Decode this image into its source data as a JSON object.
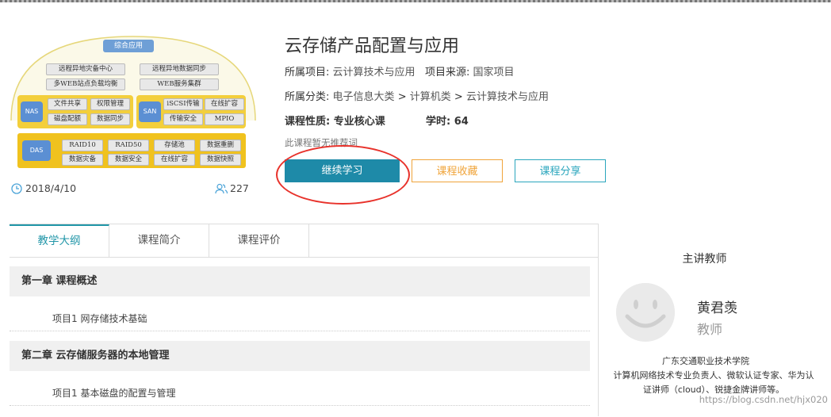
{
  "course": {
    "title": "云存储产品配置与应用",
    "project_label": "所属项目:",
    "project_value": "云计算技术与应用",
    "source_label": "项目来源:",
    "source_value": "国家项目",
    "category_label": "所属分类:",
    "category_path": [
      "电子信息大类",
      "计算机类",
      "云计算技术与应用"
    ],
    "breadcrumb_sep": ">",
    "nature_label": "课程性质: 专业核心课",
    "hours_label": "学时:",
    "hours_value": "64",
    "no_recommendation": "此课程暂无推荐词",
    "date": "2018/4/10",
    "learner_count": "227"
  },
  "buttons": {
    "continue": "继续学习",
    "favorite": "课程收藏",
    "share": "课程分享"
  },
  "diagram": {
    "top": "综合应用",
    "row1": [
      "远程异地灾备中心",
      "远程异地数据同步"
    ],
    "row2": [
      "多WEB站点负载均衡",
      "WEB服务集群"
    ],
    "nas": "NAS",
    "nas_items": [
      "文件共享",
      "权限管理",
      "磁盘配额",
      "数据同步"
    ],
    "san": "SAN",
    "san_items": [
      "iSCSI传输",
      "在线扩容",
      "传输安全",
      "MPIO"
    ],
    "das": "DAS",
    "das_items": [
      "RAID10",
      "RAID50",
      "存储池",
      "数据重删",
      "数据灾备",
      "数据安全",
      "在线扩容",
      "数据快照"
    ]
  },
  "tabs": [
    "教学大纲",
    "课程简介",
    "课程评价"
  ],
  "outline": [
    {
      "chapter": "第一章 课程概述",
      "lesson": "项目1  网存储技术基础"
    },
    {
      "chapter": "第二章 云存储服务器的本地管理",
      "lesson": "项目1  基本磁盘的配置与管理"
    }
  ],
  "teacher": {
    "section_title": "主讲教师",
    "name": "黄君羡",
    "role": "教师",
    "org": "广东交通职业技术学院",
    "desc": "计算机网络技术专业负责人、微软认证专家、华为认证讲师（cloud）、锐捷金牌讲师等。"
  },
  "watermark": "https://blog.csdn.net/hjx020",
  "colors": {
    "accent": "#1e8aa8",
    "favorite": "#f0a43a",
    "share": "#2aa6bd",
    "annotation": "#e8322b"
  }
}
